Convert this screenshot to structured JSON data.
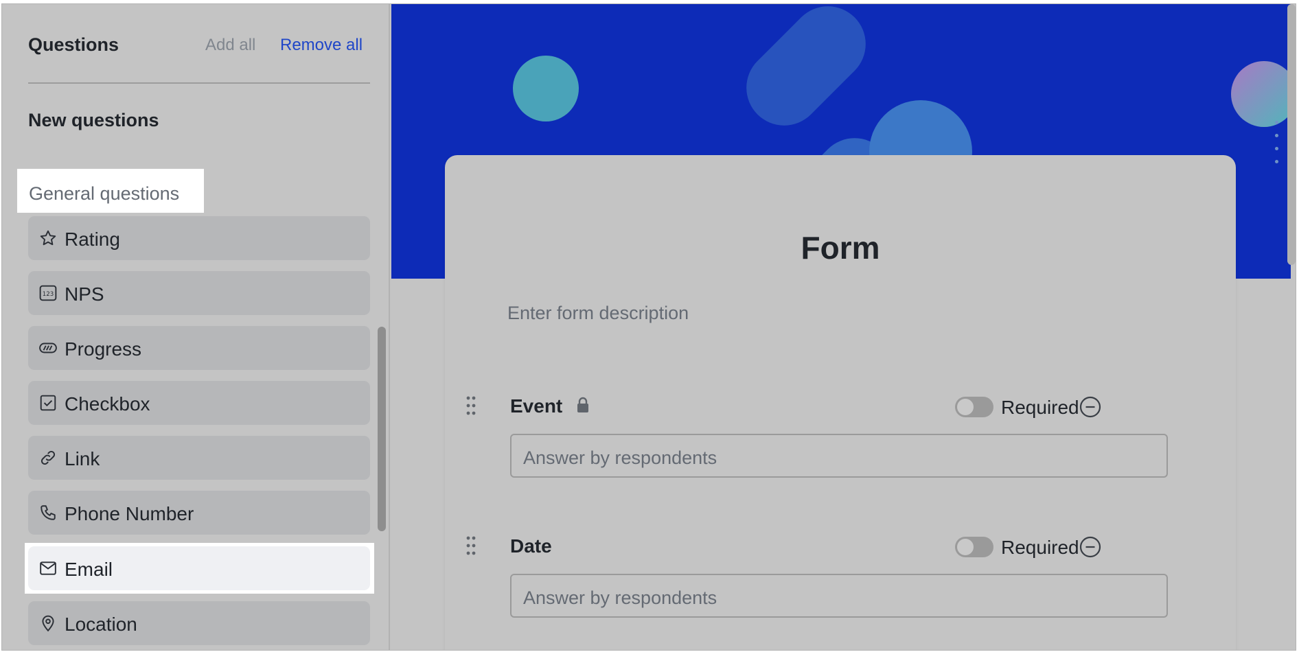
{
  "sidebar": {
    "title": "Questions",
    "add_all": "Add all",
    "remove_all": "Remove all",
    "new_questions": "New questions",
    "general_questions": "General questions",
    "items": [
      {
        "label": "Rating",
        "icon": "star-icon"
      },
      {
        "label": "NPS",
        "icon": "nps-123-icon"
      },
      {
        "label": "Progress",
        "icon": "progress-icon"
      },
      {
        "label": "Checkbox",
        "icon": "checkbox-icon"
      },
      {
        "label": "Link",
        "icon": "link-icon"
      },
      {
        "label": "Phone Number",
        "icon": "phone-icon"
      },
      {
        "label": "Email",
        "icon": "email-icon"
      },
      {
        "label": "Location",
        "icon": "location-icon"
      }
    ],
    "highlighted_item": "Email"
  },
  "form": {
    "title": "Form",
    "description_placeholder": "Enter form description",
    "fields": [
      {
        "name": "Event",
        "locked": true,
        "required_label": "Required",
        "required": false,
        "answer_placeholder": "Answer by respondents"
      },
      {
        "name": "Date",
        "locked": false,
        "required_label": "Required",
        "required": false,
        "answer_placeholder": "Answer by respondents"
      }
    ]
  },
  "colors": {
    "banner": "#0d2bb7",
    "link_accent": "#1f46c8",
    "background": "#c4c4c4"
  }
}
